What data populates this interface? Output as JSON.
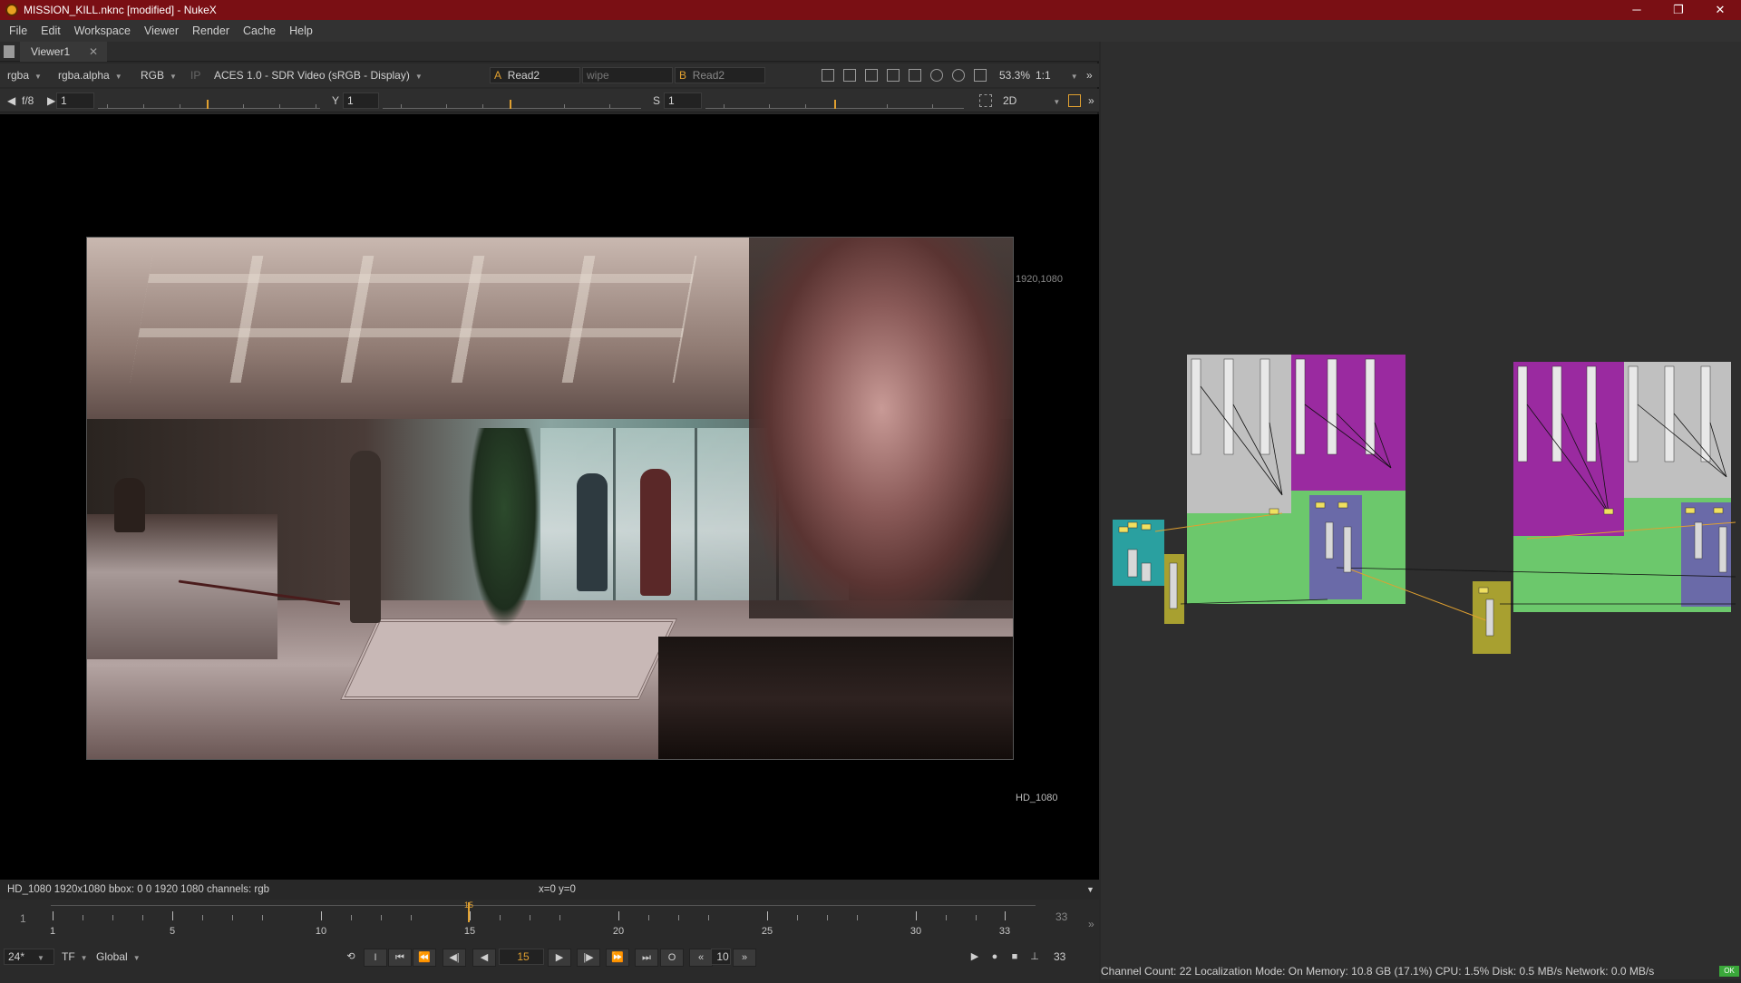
{
  "window": {
    "title": "MISSION_KILL.nknc [modified] - NukeX",
    "minimize": "─",
    "restore": "❐",
    "close": "✕"
  },
  "menu": [
    "File",
    "Edit",
    "Workspace",
    "Viewer",
    "Render",
    "Cache",
    "Help"
  ],
  "viewer_tab": {
    "label": "Viewer1",
    "close": "✕"
  },
  "toolbar": {
    "layer": "rgba",
    "channel": "rgba.alpha",
    "display_channel": "RGB",
    "ip": "IP",
    "colorspace": "ACES 1.0 - SDR Video (sRGB - Display)",
    "input_a_letter": "A",
    "input_a": "Read2",
    "wipe": "wipe",
    "input_b_letter": "B",
    "input_b": "Read2",
    "zoom": "53.3%",
    "ratio": "1:1"
  },
  "toolbar2": {
    "fstop": "f/8",
    "gain": "1",
    "gamma_label": "Y",
    "gamma": "1",
    "sat_label": "S",
    "sat": "1",
    "view_mode": "2D"
  },
  "viewer": {
    "format_top_right": "1920,1080",
    "format_bottom_right": "HD_1080"
  },
  "info": {
    "format": "HD_1080 1920x1080  bbox: 0 0 1920 1080 channels: rgb",
    "cursor": "x=0 y=0"
  },
  "timeline": {
    "start": "1",
    "end": "33",
    "current": "15",
    "labels": [
      "1",
      "5",
      "10",
      "15",
      "20",
      "25",
      "30",
      "33"
    ],
    "fps": "24*",
    "tf": "TF",
    "scope": "Global",
    "frame_field": "15",
    "step": "10",
    "end_field": "33"
  },
  "status": {
    "text": "Channel Count: 22  Localization Mode: On  Memory: 10.8 GB (17.1%)  CPU: 1.5%  Disk: 0.5 MB/s  Network: 0.0 MB/s",
    "ok": "OK"
  },
  "colors": {
    "title_bar": "#7a0f14",
    "backdrop_gray": "#c0c0c0",
    "backdrop_purple": "#9a2aa0",
    "backdrop_green": "#6cc86c",
    "backdrop_blue": "#6a6aa8",
    "backdrop_teal": "#2aa0a0",
    "backdrop_olive": "#a8a030",
    "accent_orange": "#e0a030"
  }
}
